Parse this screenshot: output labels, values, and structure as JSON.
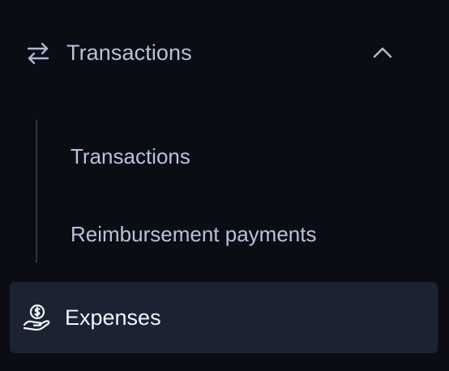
{
  "nav": {
    "group": {
      "label": "Transactions",
      "expanded": true,
      "icon": "arrows-left-right-icon",
      "chevron": "chevron-up-icon"
    },
    "sub_items": [
      {
        "label": "Transactions"
      },
      {
        "label": "Reimbursement payments"
      }
    ],
    "active_item": {
      "label": "Expenses",
      "icon": "hand-coin-icon"
    }
  },
  "colors": {
    "background": "#0a0d14",
    "text": "#b7c3dc",
    "active_background": "#1b2232",
    "active_text": "#f2f5fb",
    "divider": "#2c3445"
  }
}
